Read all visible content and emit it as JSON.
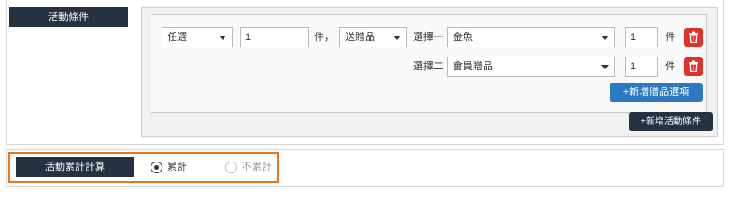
{
  "condition": {
    "section_label": "活動條件",
    "type_select": "任選",
    "qty_input": "1",
    "qty_unit": "件，",
    "action_select": "送贈品",
    "gifts": [
      {
        "label": "選擇一",
        "value": "金魚",
        "qty": "1",
        "unit": "件"
      },
      {
        "label": "選擇二",
        "value": "會員贈品",
        "qty": "1",
        "unit": "件"
      }
    ],
    "add_gift_button": "+新增贈品選項",
    "add_condition_button": "+新增活動條件"
  },
  "accumulate": {
    "section_label": "活動累計計算",
    "options": [
      {
        "label": "累計",
        "selected": true
      },
      {
        "label": "不累計",
        "selected": false
      }
    ]
  },
  "colors": {
    "dark_label": "#253241",
    "primary_button": "#2d78c4",
    "delete_button": "#e0302a",
    "highlight_border": "#e5781f"
  },
  "icons": {
    "delete": "trash-icon",
    "dropdown": "chevron-down-icon"
  }
}
